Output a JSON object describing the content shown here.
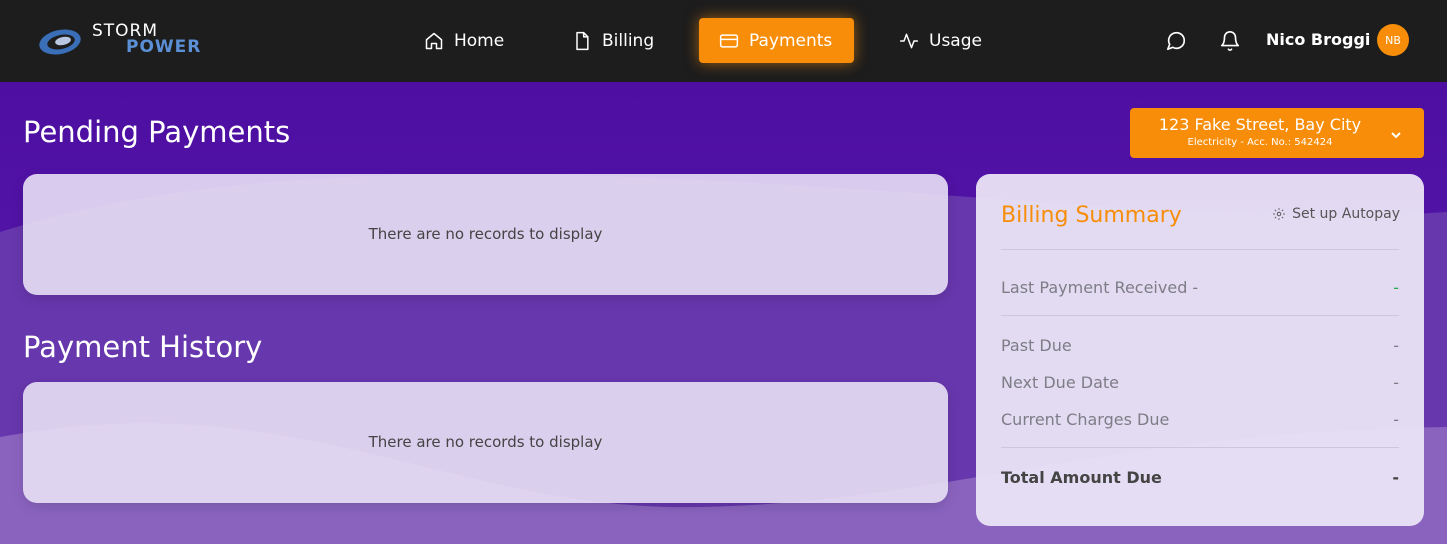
{
  "brand": {
    "line1": "STORM",
    "line2": "POWER"
  },
  "nav": {
    "items": [
      {
        "label": "Home",
        "icon": "home-icon"
      },
      {
        "label": "Billing",
        "icon": "file-icon"
      },
      {
        "label": "Payments",
        "icon": "credit-card-icon",
        "active": true
      },
      {
        "label": "Usage",
        "icon": "activity-icon"
      }
    ],
    "user_name": "Nico Broggi",
    "avatar_initials": "NB"
  },
  "account": {
    "address": "123 Fake Street, Bay City",
    "details": "Electricity - Acc. No.: 542424"
  },
  "pending": {
    "title": "Pending Payments",
    "empty_message": "There are no records to display"
  },
  "history": {
    "title": "Payment History",
    "empty_message": "There are no records to display"
  },
  "summary": {
    "title": "Billing Summary",
    "autopay_label": "Set up Autopay",
    "last_payment_label": "Last Payment Received -",
    "last_payment_value": "-",
    "past_due_label": "Past Due",
    "past_due_value": "-",
    "next_due_label": "Next Due Date",
    "next_due_value": "-",
    "current_charges_label": "Current Charges Due",
    "current_charges_value": "-",
    "total_label": "Total Amount Due",
    "total_value": "-"
  },
  "colors": {
    "accent": "#f78d09",
    "navbar": "#1d1d1d",
    "background_top": "#4b0ea0",
    "background_bottom": "#8a63bf"
  }
}
